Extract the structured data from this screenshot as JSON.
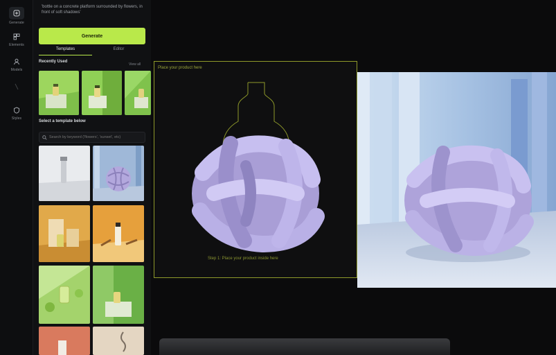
{
  "rail": {
    "items": [
      {
        "label": "Generate"
      },
      {
        "label": "Elements"
      },
      {
        "label": "Models"
      },
      {
        "label": ""
      },
      {
        "label": "Styles"
      }
    ]
  },
  "panel": {
    "prompt_text": "'bottle on a concrete platform surrounded by flowers, in front of soft shadows'",
    "generate_label": "Generate",
    "tabs": [
      "Templates",
      "Editor"
    ],
    "recently_used_title": "Recently Used",
    "view_all": "View all",
    "select_template_title": "Select a template below",
    "search_placeholder": "Search by keyword ('flowers', 'sunset', etc)"
  },
  "canvas": {
    "place_label": "Place your product here",
    "step_label": "Step 1: Place your product inside here"
  },
  "colors": {
    "accent": "#b9e94a",
    "frame": "#8f9a2a",
    "knot": "#b3a8dd"
  }
}
